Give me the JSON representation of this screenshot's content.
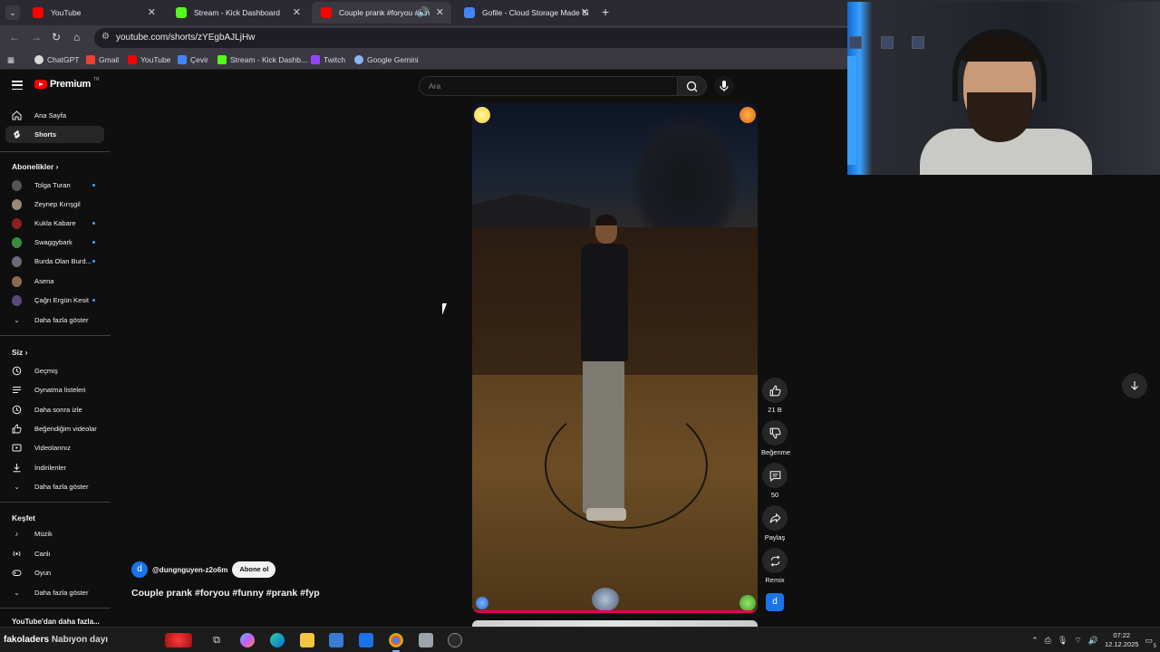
{
  "browser": {
    "tabs": [
      {
        "title": "YouTube",
        "active": false,
        "color": "#ff0000"
      },
      {
        "title": "Stream - Kick Dashboard",
        "active": false,
        "color": "#53fc18"
      },
      {
        "title": "Couple prank #foryou #fun",
        "active": true,
        "color": "#ff0000"
      },
      {
        "title": "Gofile - Cloud Storage Made Si",
        "active": false,
        "color": "#4285f4"
      }
    ],
    "new_tab": "+",
    "url": "youtube.com/shorts/zYEgbAJLjHw",
    "bookmarks": [
      {
        "label": "ChatGPT",
        "color": "#d9d9d9"
      },
      {
        "label": "Gmail",
        "color": "#ea4335"
      },
      {
        "label": "YouTube",
        "color": "#ff0000"
      },
      {
        "label": "Çevir",
        "color": "#4285f4"
      },
      {
        "label": "Stream - Kick Dashb...",
        "color": "#53fc18"
      },
      {
        "label": "Twitch",
        "color": "#9146ff"
      },
      {
        "label": "Google Gemini",
        "color": "#8ab4f8"
      }
    ]
  },
  "youtube": {
    "logo_text": "Premium",
    "logo_region": "TR",
    "search_placeholder": "Ara",
    "sidebar": {
      "main": [
        {
          "label": "Ana Sayfa",
          "icon": "home-icon",
          "active": false
        },
        {
          "label": "Shorts",
          "icon": "shorts-icon",
          "active": true
        }
      ],
      "subscriptions_header": "Abonelikler",
      "subscriptions": [
        {
          "label": "Tolga Turan",
          "dot": true,
          "color": "#555"
        },
        {
          "label": "Zeynep Kırışgil",
          "dot": false,
          "color": "#9a8a7a"
        },
        {
          "label": "Kukla Kabare",
          "dot": true,
          "color": "#8a2020"
        },
        {
          "label": "Swaggybark",
          "dot": true,
          "color": "#3a8a3a"
        },
        {
          "label": "Burda Olan Burd...",
          "dot": true,
          "color": "#6a6a7a"
        },
        {
          "label": "Asena",
          "dot": false,
          "color": "#8a6a50"
        },
        {
          "label": "Çağrı Ergün Kesit",
          "dot": true,
          "color": "#5a4a7a"
        }
      ],
      "show_more": "Daha fazla göster",
      "you_header": "Siz",
      "you": [
        {
          "label": "Geçmiş",
          "icon": "history-icon"
        },
        {
          "label": "Oynatma listeleri",
          "icon": "playlist-icon"
        },
        {
          "label": "Daha sonra izle",
          "icon": "clock-icon"
        },
        {
          "label": "Beğendiğim videolar",
          "icon": "like-icon"
        },
        {
          "label": "Videolarınız",
          "icon": "video-icon"
        },
        {
          "label": "İndirilenler",
          "icon": "download-icon"
        }
      ],
      "explore_header": "Keşfet",
      "explore": [
        {
          "label": "Müzik",
          "icon": "music-icon"
        },
        {
          "label": "Canlı",
          "icon": "live-icon"
        },
        {
          "label": "Oyun",
          "icon": "gamepad-icon"
        }
      ],
      "more_from_youtube": "YouTube'dan daha fazla..."
    },
    "short": {
      "channel": "@dungnguyen-z2o6m",
      "channel_initial": "d",
      "subscribe": "Abone ol",
      "title": "Couple prank #foryou #funny #prank #fyp",
      "likes": "21 B",
      "dislike": "Beğenme",
      "comments": "50",
      "share": "Paylaş",
      "remix": "Remix",
      "progress": 1.0
    }
  },
  "taskbar": {
    "left_brand": "fakoladers",
    "left_text": "Nabıyon dayı",
    "time": "07:22",
    "date": "12.12.2025",
    "notifications": "5"
  }
}
